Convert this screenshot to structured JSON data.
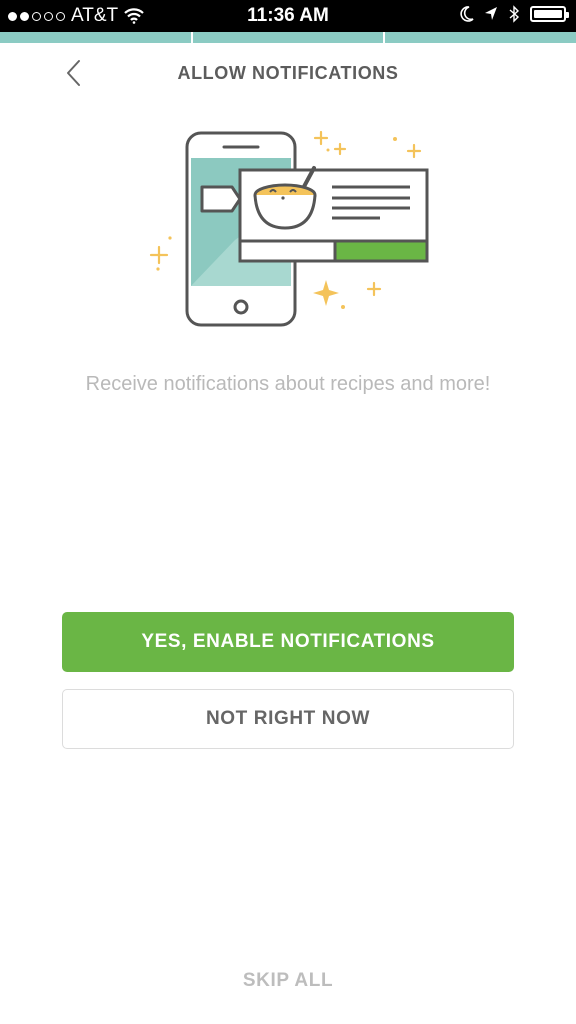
{
  "status_bar": {
    "carrier": "AT&T",
    "time": "11:36 AM",
    "signal_bars_filled": 2,
    "signal_bars_total": 5,
    "battery_level": 1.0
  },
  "progress": {
    "segments": 3
  },
  "header": {
    "title": "ALLOW NOTIFICATIONS",
    "back_icon": "chevron-left-icon"
  },
  "main": {
    "subtitle": "Receive notifications about recipes and more!"
  },
  "actions": {
    "enable_label": "YES, ENABLE NOTIFICATIONS",
    "decline_label": "NOT RIGHT NOW",
    "skip_label": "SKIP ALL"
  },
  "colors": {
    "accent_green": "#6ab645",
    "progress_teal": "#8bcbc3",
    "illustration_teal": "#8cc9c0",
    "sparkle_yellow": "#f4c35a",
    "text_gray": "#5c5c5c",
    "muted_gray": "#b9b9b9"
  }
}
